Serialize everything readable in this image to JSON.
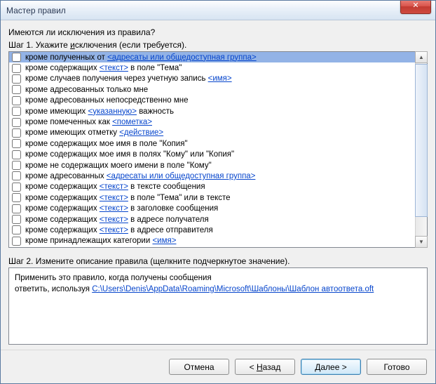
{
  "window": {
    "title": "Мастер правил"
  },
  "question": "Имеются ли исключения из правила?",
  "step1": {
    "prefix": "Шаг 1. Укажите ",
    "ul": "и",
    "mid": "сключения (если требуется)."
  },
  "rows": [
    {
      "selected": true,
      "parts": [
        {
          "t": "кроме полученных от "
        },
        {
          "t": "<адресаты или общедоступная группа>",
          "link": true
        }
      ]
    },
    {
      "parts": [
        {
          "t": "кроме содержащих "
        },
        {
          "t": "<текст>",
          "link": true
        },
        {
          "t": " в поле \"Тема\""
        }
      ]
    },
    {
      "parts": [
        {
          "t": "кроме случаев получения через учетную запись "
        },
        {
          "t": "<имя>",
          "link": true
        }
      ]
    },
    {
      "parts": [
        {
          "t": "кроме адресованных только мне"
        }
      ]
    },
    {
      "parts": [
        {
          "t": "кроме адресованных непосредственно мне"
        }
      ]
    },
    {
      "parts": [
        {
          "t": "кроме имеющих "
        },
        {
          "t": "<указанную>",
          "link": true
        },
        {
          "t": " важность"
        }
      ]
    },
    {
      "parts": [
        {
          "t": "кроме помеченных как "
        },
        {
          "t": "<пометка>",
          "link": true
        }
      ]
    },
    {
      "parts": [
        {
          "t": "кроме имеющих отметку "
        },
        {
          "t": "<действие>",
          "link": true
        }
      ]
    },
    {
      "parts": [
        {
          "t": "кроме содержащих мое имя в поле \"Копия\""
        }
      ]
    },
    {
      "parts": [
        {
          "t": "кроме содержащих мое имя в полях \"Кому\" или \"Копия\""
        }
      ]
    },
    {
      "parts": [
        {
          "t": "кроме не содержащих моего имени в поле \"Кому\""
        }
      ]
    },
    {
      "parts": [
        {
          "t": "кроме адресованных "
        },
        {
          "t": "<адресаты или общедоступная группа>",
          "link": true
        }
      ]
    },
    {
      "parts": [
        {
          "t": "кроме содержащих "
        },
        {
          "t": "<текст>",
          "link": true
        },
        {
          "t": " в тексте сообщения"
        }
      ]
    },
    {
      "parts": [
        {
          "t": "кроме содержащих "
        },
        {
          "t": "<текст>",
          "link": true
        },
        {
          "t": " в поле \"Тема\" или в тексте"
        }
      ]
    },
    {
      "parts": [
        {
          "t": "кроме содержащих "
        },
        {
          "t": "<текст>",
          "link": true
        },
        {
          "t": " в заголовке сообщения"
        }
      ]
    },
    {
      "parts": [
        {
          "t": "кроме содержащих "
        },
        {
          "t": "<текст>",
          "link": true
        },
        {
          "t": " в адресе получателя"
        }
      ]
    },
    {
      "parts": [
        {
          "t": "кроме содержащих "
        },
        {
          "t": "<текст>",
          "link": true
        },
        {
          "t": " в адресе отправителя"
        }
      ]
    },
    {
      "parts": [
        {
          "t": "кроме принадлежащих категории "
        },
        {
          "t": "<имя>",
          "link": true
        }
      ]
    }
  ],
  "step2": "Шаг 2. Измените описание правила (щелкните подчеркнутое значение).",
  "desc": {
    "line1": "Применить это правило, когда получены сообщения",
    "line2_prefix": "ответить, используя ",
    "line2_link": "C:\\Users\\Denis\\AppData\\Roaming\\Microsoft\\Шаблоны\\Шаблон автоответа.oft"
  },
  "buttons": {
    "cancel": "Отмена",
    "back_prefix": "< ",
    "back_ul": "Н",
    "back_rest": "азад",
    "next_ul": "Д",
    "next_rest": "алее >",
    "finish": "Готово"
  }
}
